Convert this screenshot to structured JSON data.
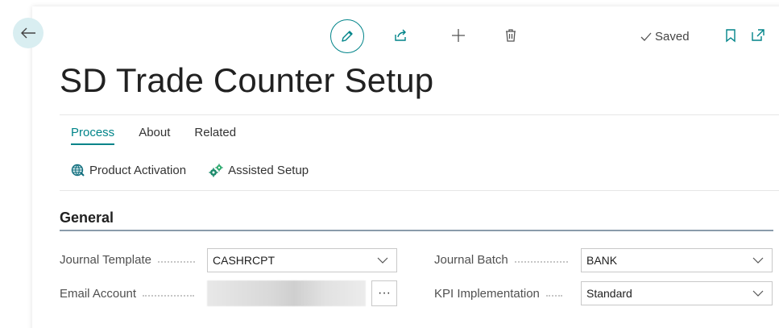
{
  "header": {
    "saved_label": "Saved"
  },
  "title": "SD Trade Counter Setup",
  "tabs": [
    {
      "label": "Process"
    },
    {
      "label": "About"
    },
    {
      "label": "Related"
    }
  ],
  "actions": [
    {
      "label": "Product Activation",
      "icon": "globe-icon"
    },
    {
      "label": "Assisted Setup",
      "icon": "gears-icon"
    }
  ],
  "section": {
    "title": "General"
  },
  "fields": {
    "journal_template": {
      "label": "Journal Template",
      "value": "CASHRCPT"
    },
    "email_account": {
      "label": "Email Account",
      "lookup": "···"
    },
    "journal_batch": {
      "label": "Journal Batch",
      "value": "BANK"
    },
    "kpi_implementation": {
      "label": "KPI Implementation",
      "value": "Standard"
    }
  },
  "colors": {
    "accent": "#008489",
    "back_bg": "#d9eef1"
  }
}
